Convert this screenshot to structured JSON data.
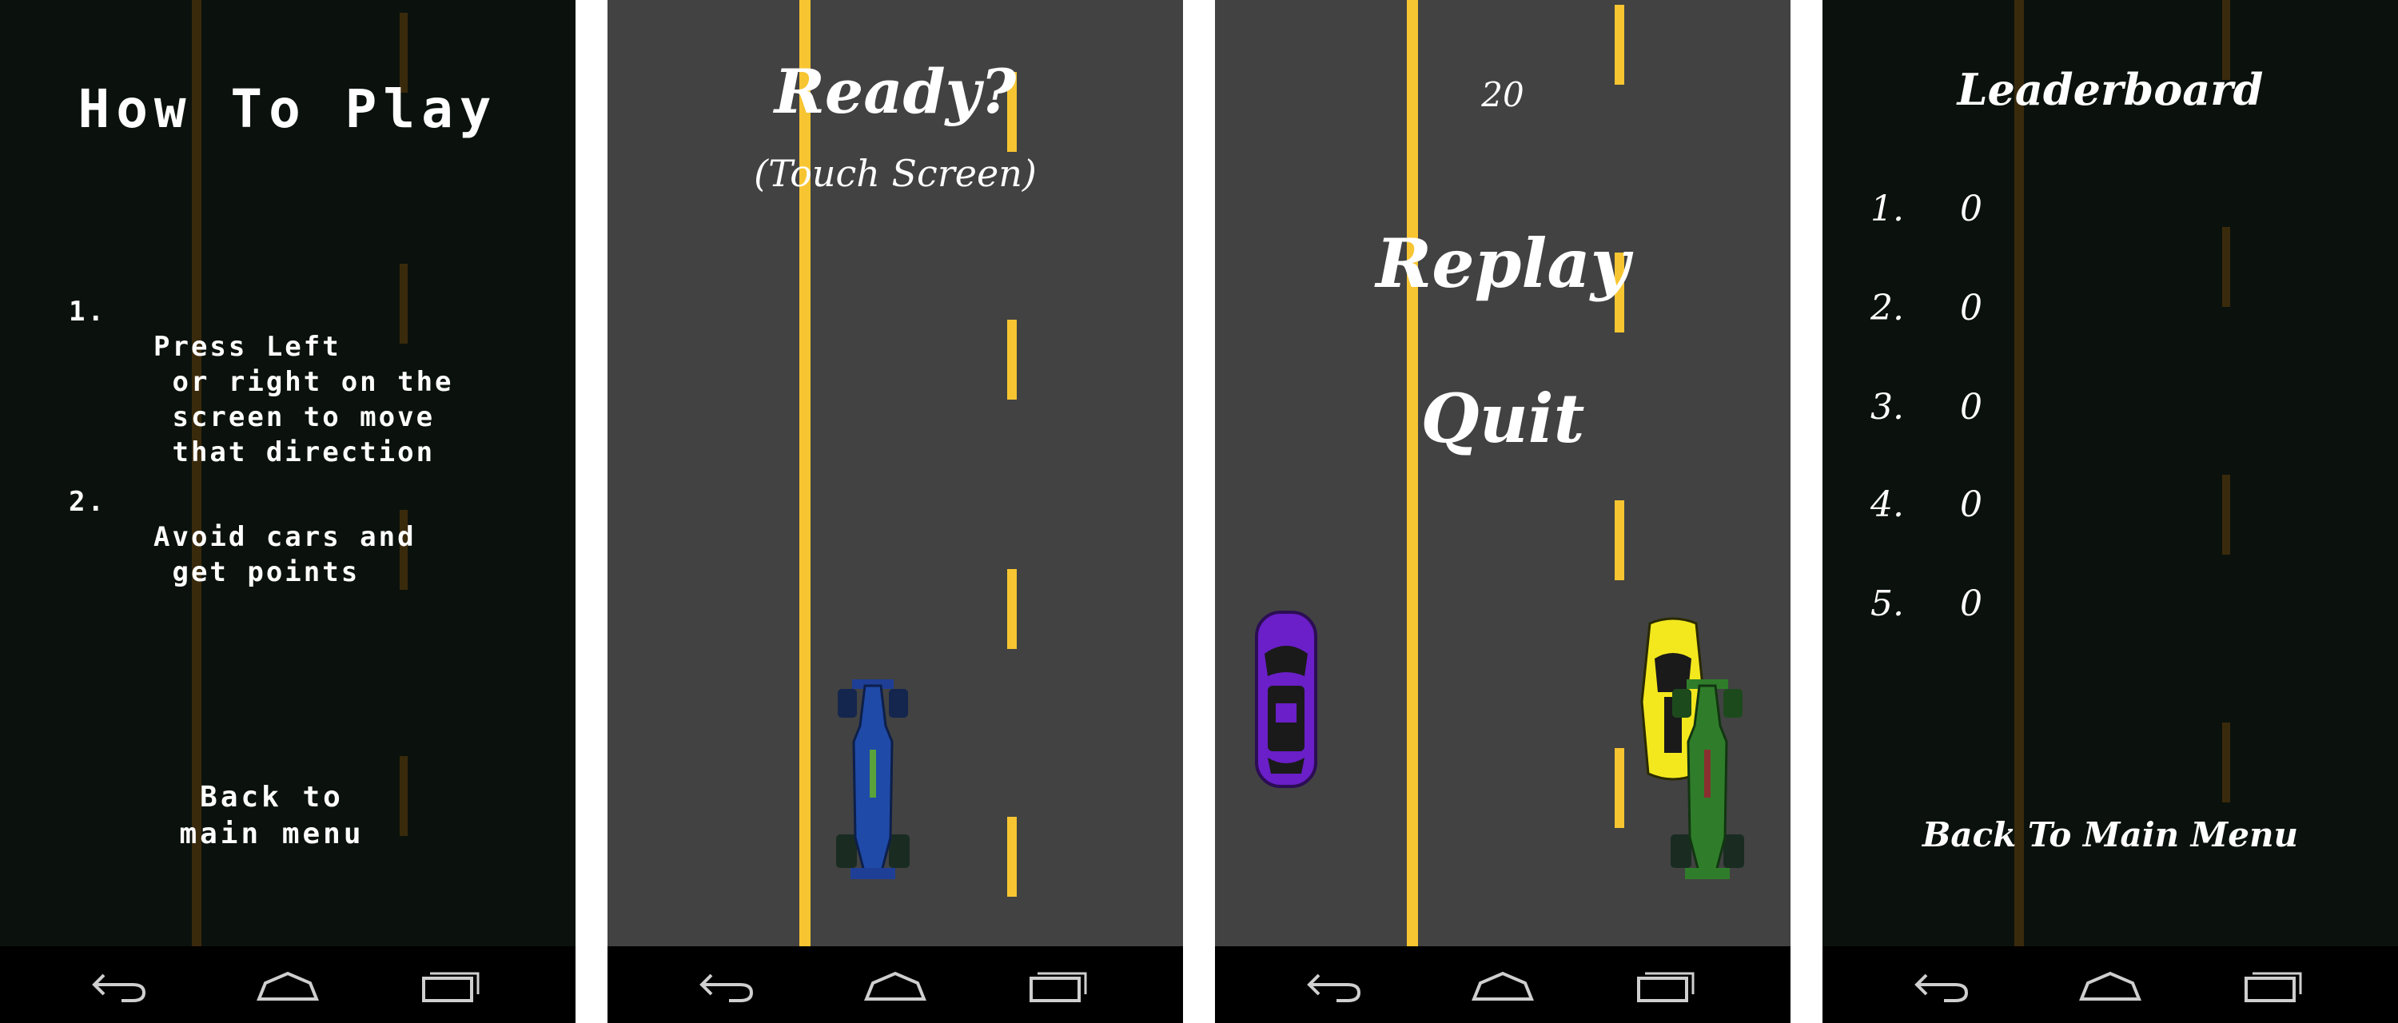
{
  "how_to_play": {
    "title": "How To Play",
    "steps": [
      {
        "num": "1.",
        "text": "Press Left\n or right on the\n screen to move\n that direction"
      },
      {
        "num": "2.",
        "text": "Avoid cars and\n get points"
      }
    ],
    "back_label": "Back to\nmain menu"
  },
  "ready_screen": {
    "title": "Ready?",
    "subtitle": "(Touch Screen)"
  },
  "game_over": {
    "score": "20",
    "replay_label": "Replay",
    "quit_label": "Quit"
  },
  "leaderboard": {
    "title": "Leaderboard",
    "entries": [
      {
        "rank": "1.",
        "score": "0"
      },
      {
        "rank": "2.",
        "score": "0"
      },
      {
        "rank": "3.",
        "score": "0"
      },
      {
        "rank": "4.",
        "score": "0"
      },
      {
        "rank": "5.",
        "score": "0"
      }
    ],
    "back_label": "Back To Main Menu"
  },
  "colors": {
    "road": "#424242",
    "dark_bg": "#0b120d",
    "lane_yellow": "#f7c531",
    "dim_line": "#3a2a0c",
    "nav_bg": "#000000"
  },
  "icons": {
    "nav_back": "back-arrow-icon",
    "nav_home": "home-icon",
    "nav_recents": "recents-icon"
  }
}
